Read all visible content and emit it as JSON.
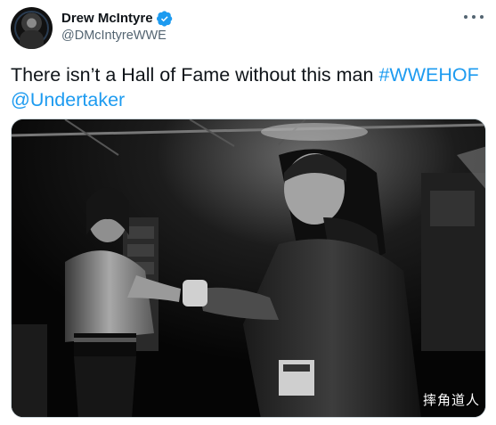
{
  "author": {
    "display_name": "Drew McIntyre",
    "handle": "@DMcIntyreWWE",
    "avatar_icon": "profile-avatar",
    "verified_icon": "verified-badge-icon",
    "verified_color": "#1d9bf0"
  },
  "menu_icon": "more-options-icon",
  "tweet": {
    "text": "There isn’t a Hall of Fame without this man ",
    "hashtag": "#WWEHOF",
    "mention": "@Undertaker",
    "link_color": "#1d9bf0"
  },
  "media": {
    "watermark": "摔角道人"
  }
}
